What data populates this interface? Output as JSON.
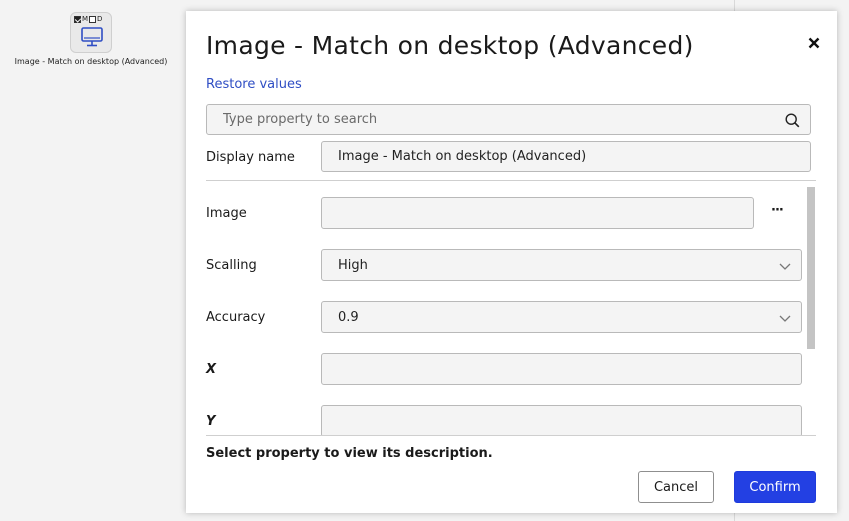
{
  "canvas": {
    "node": {
      "flag_m": "M",
      "flag_d": "D",
      "label": "Image - Match on desktop (Advanced)",
      "icon": "monitor-icon"
    }
  },
  "dialog": {
    "title": "Image - Match on desktop (Advanced)",
    "close_icon": "close-icon",
    "restore_label": "Restore values",
    "search": {
      "placeholder": "Type property to search",
      "value": "",
      "icon": "search-icon"
    },
    "display_name": {
      "label": "Display name",
      "value": "Image - Match on desktop (Advanced)"
    },
    "properties": {
      "image": {
        "label": "Image",
        "value": "",
        "browse_label": "···"
      },
      "scalling": {
        "label": "Scalling",
        "value": "High"
      },
      "accuracy": {
        "label": "Accuracy",
        "value": "0.9"
      },
      "x": {
        "label": "X",
        "value": ""
      },
      "y": {
        "label": "Y",
        "value": ""
      }
    },
    "description": "Select property to view its description.",
    "buttons": {
      "cancel": "Cancel",
      "confirm": "Confirm"
    }
  },
  "colors": {
    "accent": "#2340e3",
    "link": "#2f4ec4"
  }
}
